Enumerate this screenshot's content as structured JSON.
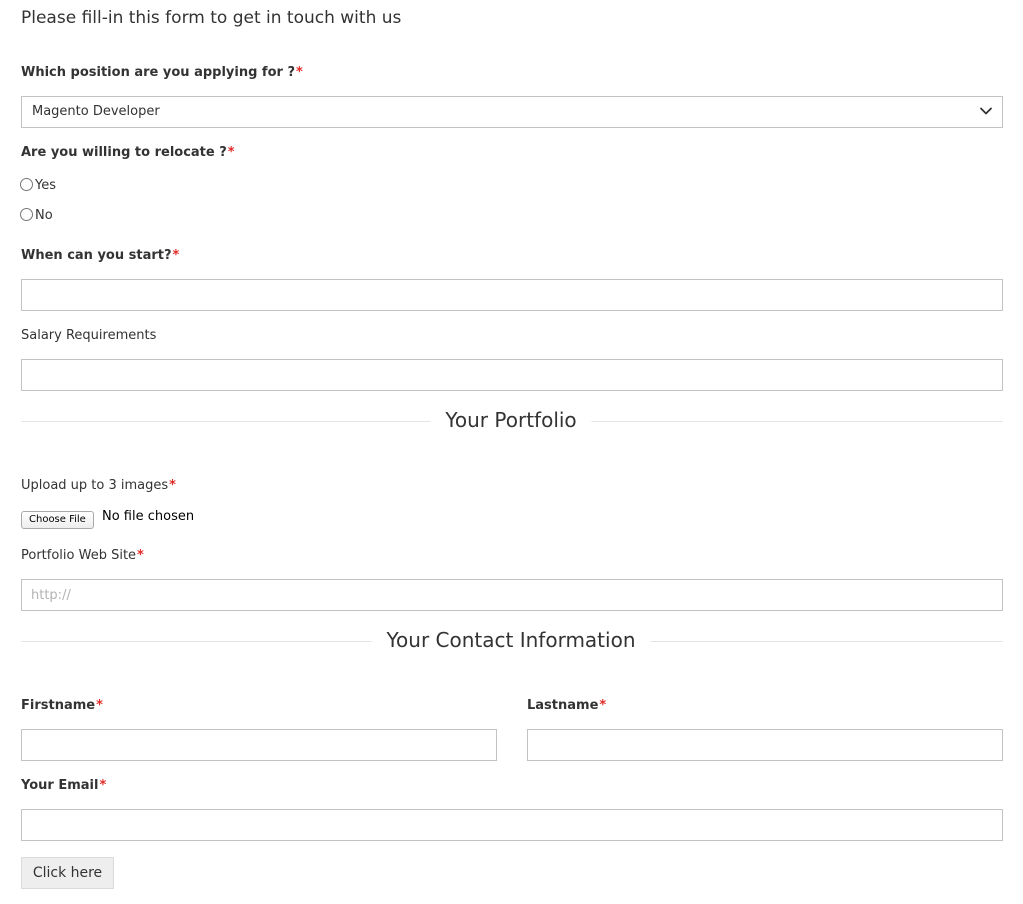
{
  "form": {
    "intro": "Please fill-in this form to get in touch with us",
    "required_marker": "*",
    "position": {
      "label": "Which position are you applying for ?",
      "selected": "Magento Developer"
    },
    "relocate": {
      "label": "Are you willing to relocate ?",
      "options": [
        "Yes",
        "No"
      ]
    },
    "start": {
      "label": "When can you start?",
      "value": ""
    },
    "salary": {
      "label": "Salary Requirements",
      "value": ""
    },
    "portfolio_section": {
      "title": "Your Portfolio"
    },
    "upload": {
      "label": "Upload up to 3 images",
      "button_label": "Choose File",
      "status": "No file chosen"
    },
    "website": {
      "label": "Portfolio Web Site",
      "placeholder": "http://",
      "value": ""
    },
    "contact_section": {
      "title": "Your Contact Information"
    },
    "firstname": {
      "label": "Firstname",
      "value": ""
    },
    "lastname": {
      "label": "Lastname",
      "value": ""
    },
    "email": {
      "label": "Your Email",
      "value": ""
    },
    "submit": {
      "label": "Click here"
    }
  },
  "icons": {
    "select_arrow": "chevron-down-icon"
  },
  "colors": {
    "required": "#e02b27",
    "border": "#c2c2c2",
    "text": "#333333",
    "button_bg": "#eeeeee",
    "divider": "#e4e4e4"
  }
}
